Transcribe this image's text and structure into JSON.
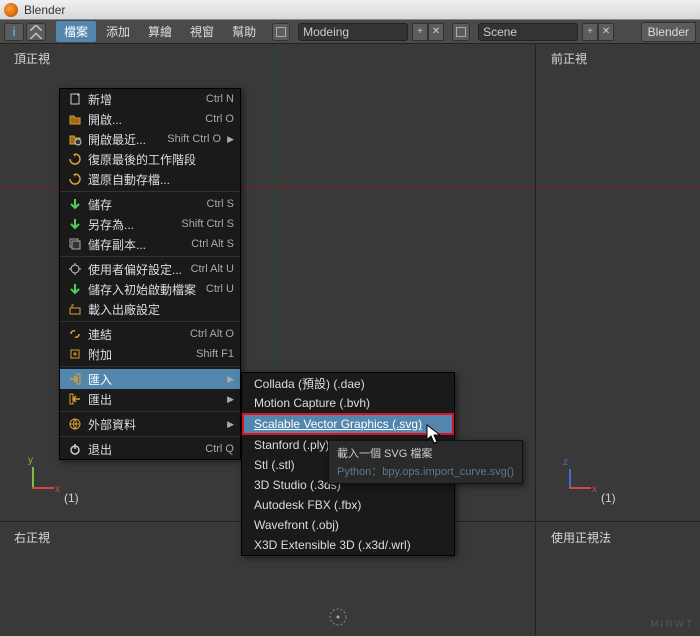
{
  "window": {
    "title": "Blender"
  },
  "topbar": {
    "menus": [
      "檔案",
      "添加",
      "算繪",
      "視窗",
      "幫助"
    ],
    "activeIndex": 0,
    "modeField": "Modeing",
    "sceneField": "Scene",
    "rightLabel": "Blender"
  },
  "viewports": {
    "topLeftLabel": "頂正視",
    "topRightLabel": "前正視",
    "bottomLeftLabel": "右正視",
    "bottomRightLabel": "使用正視法",
    "layerLabel": "(1)"
  },
  "fileMenu": [
    {
      "type": "item",
      "icon": "file-new",
      "label": "新增",
      "shortcut": "Ctrl N"
    },
    {
      "type": "item",
      "icon": "folder",
      "label": "開啟...",
      "shortcut": "Ctrl O"
    },
    {
      "type": "item",
      "icon": "folder-recent",
      "label": "開啟最近...",
      "shortcut": "Shift Ctrl O",
      "sub": true
    },
    {
      "type": "item",
      "icon": "recover",
      "label": "復原最後的工作階段",
      "dim": false
    },
    {
      "type": "item",
      "icon": "recover",
      "label": "還原自動存檔..."
    },
    {
      "type": "sep"
    },
    {
      "type": "item",
      "icon": "save",
      "label": "儲存",
      "shortcut": "Ctrl S"
    },
    {
      "type": "item",
      "icon": "save",
      "label": "另存為...",
      "shortcut": "Shift Ctrl S"
    },
    {
      "type": "item",
      "icon": "save-copy",
      "label": "儲存副本...",
      "shortcut": "Ctrl Alt S"
    },
    {
      "type": "sep"
    },
    {
      "type": "item",
      "icon": "prefs",
      "label": "使用者偏好設定...",
      "shortcut": "Ctrl Alt U"
    },
    {
      "type": "item",
      "icon": "save",
      "label": "儲存入初始啟動檔案",
      "shortcut": "Ctrl U"
    },
    {
      "type": "item",
      "icon": "factory",
      "label": "載入出廠設定"
    },
    {
      "type": "sep"
    },
    {
      "type": "item",
      "icon": "link",
      "label": "連結",
      "shortcut": "Ctrl Alt O"
    },
    {
      "type": "item",
      "icon": "append",
      "label": "附加",
      "shortcut": "Shift F1"
    },
    {
      "type": "sep"
    },
    {
      "type": "item",
      "icon": "import",
      "label": "匯入",
      "sub": true,
      "highlight": true
    },
    {
      "type": "item",
      "icon": "export",
      "label": "匯出",
      "sub": true
    },
    {
      "type": "sep"
    },
    {
      "type": "item",
      "icon": "external",
      "label": "外部資料",
      "sub": true
    },
    {
      "type": "sep"
    },
    {
      "type": "item",
      "icon": "quit",
      "label": "退出",
      "shortcut": "Ctrl Q"
    }
  ],
  "importSubmenu": [
    {
      "label": "Collada (預設) (.dae)"
    },
    {
      "label": "Motion Capture (.bvh)"
    },
    {
      "label": "Scalable Vector Graphics (.svg)",
      "highlight": true
    },
    {
      "label": "Stanford (.ply)"
    },
    {
      "label": "Stl (.stl)"
    },
    {
      "label": "3D Studio (.3ds)"
    },
    {
      "label": "Autodesk FBX (.fbx)"
    },
    {
      "label": "Wavefront (.obj)"
    },
    {
      "label": "X3D Extensible 3D (.x3d/.wrl)"
    }
  ],
  "tooltip": {
    "title": "載入一個 SVG 檔案",
    "python": "Python：bpy.ops.import_curve.svg()"
  },
  "watermark": "MINWT"
}
